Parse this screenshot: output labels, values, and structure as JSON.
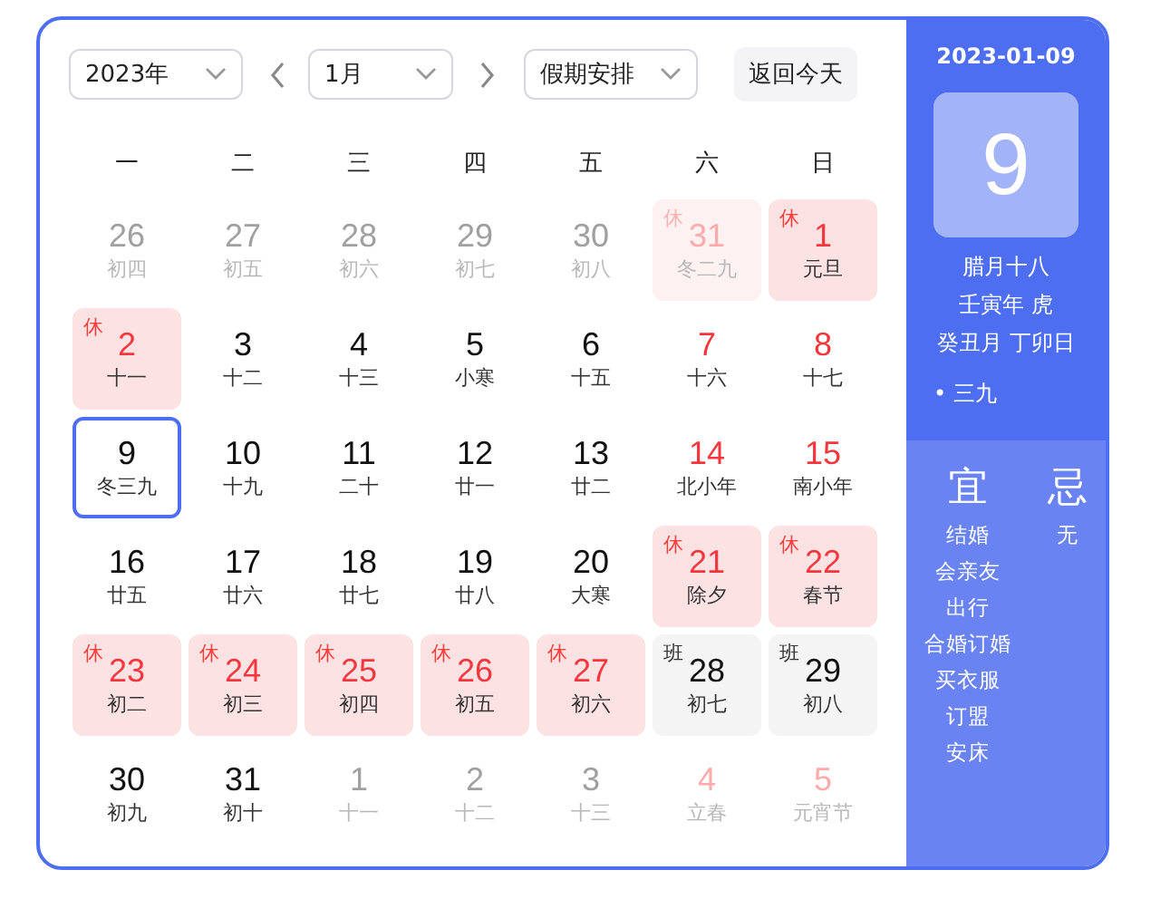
{
  "toolbar": {
    "year": {
      "value": "2023年"
    },
    "month": {
      "value": "1月"
    },
    "holiday": {
      "value": "假期安排"
    },
    "today_button": "返回今天"
  },
  "weekdays": [
    "一",
    "二",
    "三",
    "四",
    "五",
    "六",
    "日"
  ],
  "days": [
    {
      "day": "26",
      "lunar": "初四",
      "in_month": false,
      "kind": "plain",
      "selected": false
    },
    {
      "day": "27",
      "lunar": "初五",
      "in_month": false,
      "kind": "plain",
      "selected": false
    },
    {
      "day": "28",
      "lunar": "初六",
      "in_month": false,
      "kind": "plain",
      "selected": false
    },
    {
      "day": "29",
      "lunar": "初七",
      "in_month": false,
      "kind": "plain",
      "selected": false
    },
    {
      "day": "30",
      "lunar": "初八",
      "in_month": false,
      "kind": "plain",
      "selected": false
    },
    {
      "day": "31",
      "lunar": "冬二九",
      "in_month": false,
      "kind": "rest",
      "badge": "休",
      "selected": false
    },
    {
      "day": "1",
      "lunar": "元旦",
      "in_month": true,
      "kind": "rest",
      "badge": "休",
      "selected": false
    },
    {
      "day": "2",
      "lunar": "十一",
      "in_month": true,
      "kind": "rest",
      "badge": "休",
      "selected": false
    },
    {
      "day": "3",
      "lunar": "十二",
      "in_month": true,
      "kind": "plain",
      "selected": false
    },
    {
      "day": "4",
      "lunar": "十三",
      "in_month": true,
      "kind": "plain",
      "selected": false
    },
    {
      "day": "5",
      "lunar": "小寒",
      "in_month": true,
      "kind": "plain",
      "selected": false
    },
    {
      "day": "6",
      "lunar": "十五",
      "in_month": true,
      "kind": "plain",
      "selected": false
    },
    {
      "day": "7",
      "lunar": "十六",
      "in_month": true,
      "kind": "plain",
      "selected": false
    },
    {
      "day": "8",
      "lunar": "十七",
      "in_month": true,
      "kind": "plain",
      "selected": false
    },
    {
      "day": "9",
      "lunar": "冬三九",
      "in_month": true,
      "kind": "plain",
      "selected": true
    },
    {
      "day": "10",
      "lunar": "十九",
      "in_month": true,
      "kind": "plain",
      "selected": false
    },
    {
      "day": "11",
      "lunar": "二十",
      "in_month": true,
      "kind": "plain",
      "selected": false
    },
    {
      "day": "12",
      "lunar": "廿一",
      "in_month": true,
      "kind": "plain",
      "selected": false
    },
    {
      "day": "13",
      "lunar": "廿二",
      "in_month": true,
      "kind": "plain",
      "selected": false
    },
    {
      "day": "14",
      "lunar": "北小年",
      "in_month": true,
      "kind": "plain",
      "selected": false
    },
    {
      "day": "15",
      "lunar": "南小年",
      "in_month": true,
      "kind": "plain",
      "selected": false
    },
    {
      "day": "16",
      "lunar": "廿五",
      "in_month": true,
      "kind": "plain",
      "selected": false
    },
    {
      "day": "17",
      "lunar": "廿六",
      "in_month": true,
      "kind": "plain",
      "selected": false
    },
    {
      "day": "18",
      "lunar": "廿七",
      "in_month": true,
      "kind": "plain",
      "selected": false
    },
    {
      "day": "19",
      "lunar": "廿八",
      "in_month": true,
      "kind": "plain",
      "selected": false
    },
    {
      "day": "20",
      "lunar": "大寒",
      "in_month": true,
      "kind": "plain",
      "selected": false
    },
    {
      "day": "21",
      "lunar": "除夕",
      "in_month": true,
      "kind": "rest",
      "badge": "休",
      "selected": false
    },
    {
      "day": "22",
      "lunar": "春节",
      "in_month": true,
      "kind": "rest",
      "badge": "休",
      "selected": false
    },
    {
      "day": "23",
      "lunar": "初二",
      "in_month": true,
      "kind": "rest",
      "badge": "休",
      "selected": false
    },
    {
      "day": "24",
      "lunar": "初三",
      "in_month": true,
      "kind": "rest",
      "badge": "休",
      "selected": false
    },
    {
      "day": "25",
      "lunar": "初四",
      "in_month": true,
      "kind": "rest",
      "badge": "休",
      "selected": false
    },
    {
      "day": "26",
      "lunar": "初五",
      "in_month": true,
      "kind": "rest",
      "badge": "休",
      "selected": false
    },
    {
      "day": "27",
      "lunar": "初六",
      "in_month": true,
      "kind": "rest",
      "badge": "休",
      "selected": false
    },
    {
      "day": "28",
      "lunar": "初七",
      "in_month": true,
      "kind": "work",
      "badge": "班",
      "selected": false
    },
    {
      "day": "29",
      "lunar": "初八",
      "in_month": true,
      "kind": "work",
      "badge": "班",
      "selected": false
    },
    {
      "day": "30",
      "lunar": "初九",
      "in_month": true,
      "kind": "plain",
      "selected": false
    },
    {
      "day": "31",
      "lunar": "初十",
      "in_month": true,
      "kind": "plain",
      "selected": false
    },
    {
      "day": "1",
      "lunar": "十一",
      "in_month": false,
      "kind": "plain",
      "selected": false
    },
    {
      "day": "2",
      "lunar": "十二",
      "in_month": false,
      "kind": "plain",
      "selected": false
    },
    {
      "day": "3",
      "lunar": "十三",
      "in_month": false,
      "kind": "plain",
      "selected": false
    },
    {
      "day": "4",
      "lunar": "立春",
      "in_month": false,
      "kind": "plain",
      "selected": false
    },
    {
      "day": "5",
      "lunar": "元宵节",
      "in_month": false,
      "kind": "plain",
      "selected": false
    }
  ],
  "detail": {
    "date": "2023-01-09",
    "day": "9",
    "lunar_lines": [
      "腊月十八",
      "壬寅年 虎",
      "癸丑月 丁卯日"
    ],
    "solar_term": "• 三九",
    "good": {
      "title": "宜",
      "items": [
        "结婚",
        "会亲友",
        "出行",
        "合婚订婚",
        "买衣服",
        "订盟",
        "安床"
      ]
    },
    "bad": {
      "title": "忌",
      "items": [
        "无"
      ]
    }
  }
}
